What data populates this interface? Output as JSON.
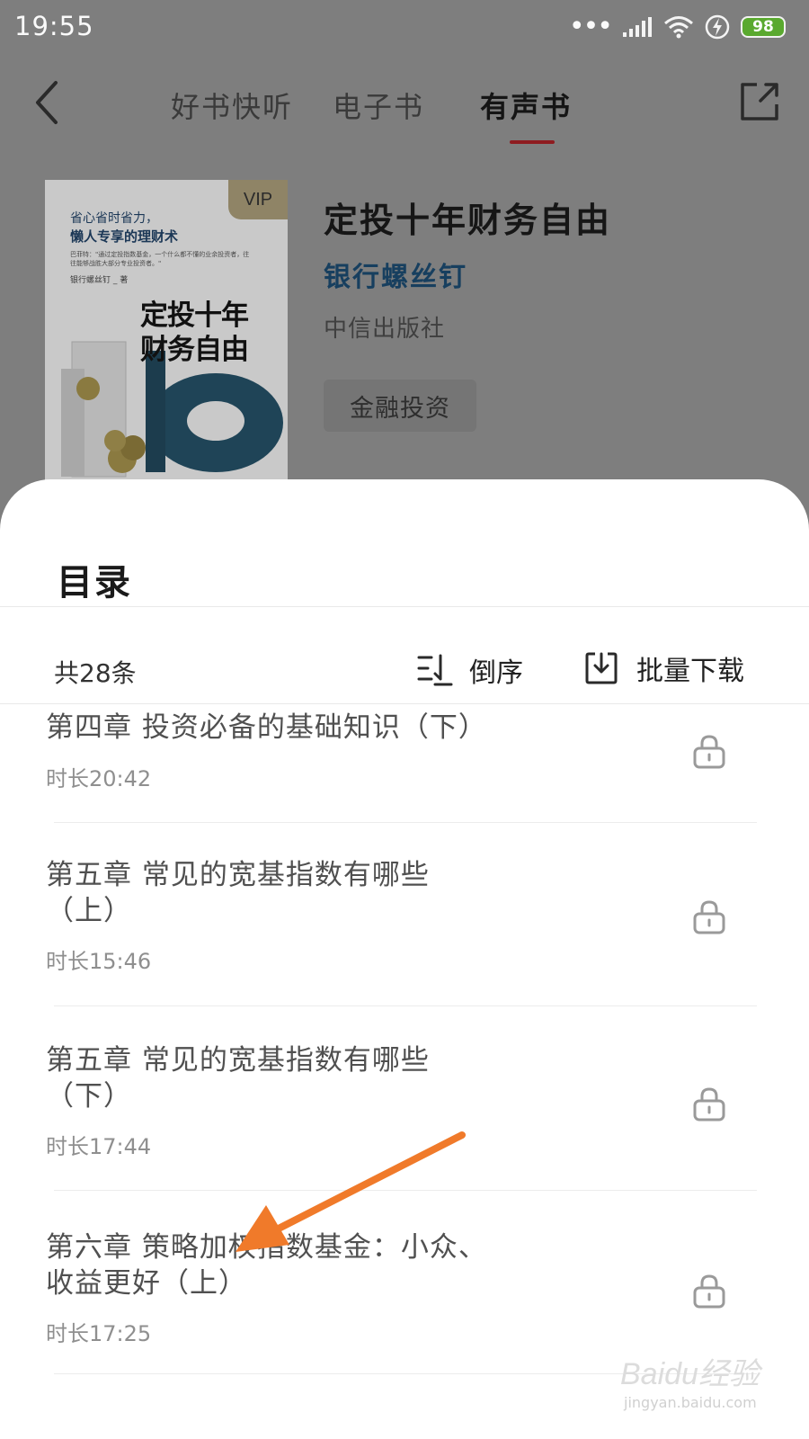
{
  "status_bar": {
    "time": "19:55",
    "battery": "98"
  },
  "nav": {
    "tabs": [
      {
        "label": "好书快听",
        "active": false
      },
      {
        "label": "电子书",
        "active": false
      },
      {
        "label": "有声书",
        "active": true
      }
    ],
    "underline_color": "#c8262c"
  },
  "book": {
    "title": "定投十年财务自由",
    "author": "银行螺丝钉",
    "publisher": "中信出版社",
    "tag": "金融投资",
    "vip_badge": "VIP",
    "cover": {
      "tagline_1": "省心省时省力，",
      "tagline_2": "懒人专享的理财术",
      "blurb": "巴菲特：\"通过定投指数基金，一个什么都不懂的业余投资者，往往能够战胜大部分专业投资者。\"",
      "author_line": "银行螺丝钉 _ 著",
      "title_line_1": "定投十年",
      "title_line_2": "财务自由"
    }
  },
  "sheet": {
    "title": "目录",
    "count": "共28条",
    "sort_label": "倒序",
    "download_label": "批量下载"
  },
  "chapters": [
    {
      "title": "第四章 投资必备的基础知识（下）",
      "duration": "时长20:42",
      "locked": true
    },
    {
      "title": "第五章 常见的宽基指数有哪些（上）",
      "duration": "时长15:46",
      "locked": true
    },
    {
      "title": "第五章 常见的宽基指数有哪些（下）",
      "duration": "时长17:44",
      "locked": true
    },
    {
      "title": "第六章 策略加权指数基金：小众、收益更好（上）",
      "duration": "时长17:25",
      "locked": true
    }
  ],
  "watermark": {
    "brand": "Baidu经验",
    "url": "jingyan.baidu.com"
  },
  "colors": {
    "accent_arrow": "#f07a2a",
    "author_blue": "#3a8fd0",
    "overlay": "#808080"
  }
}
